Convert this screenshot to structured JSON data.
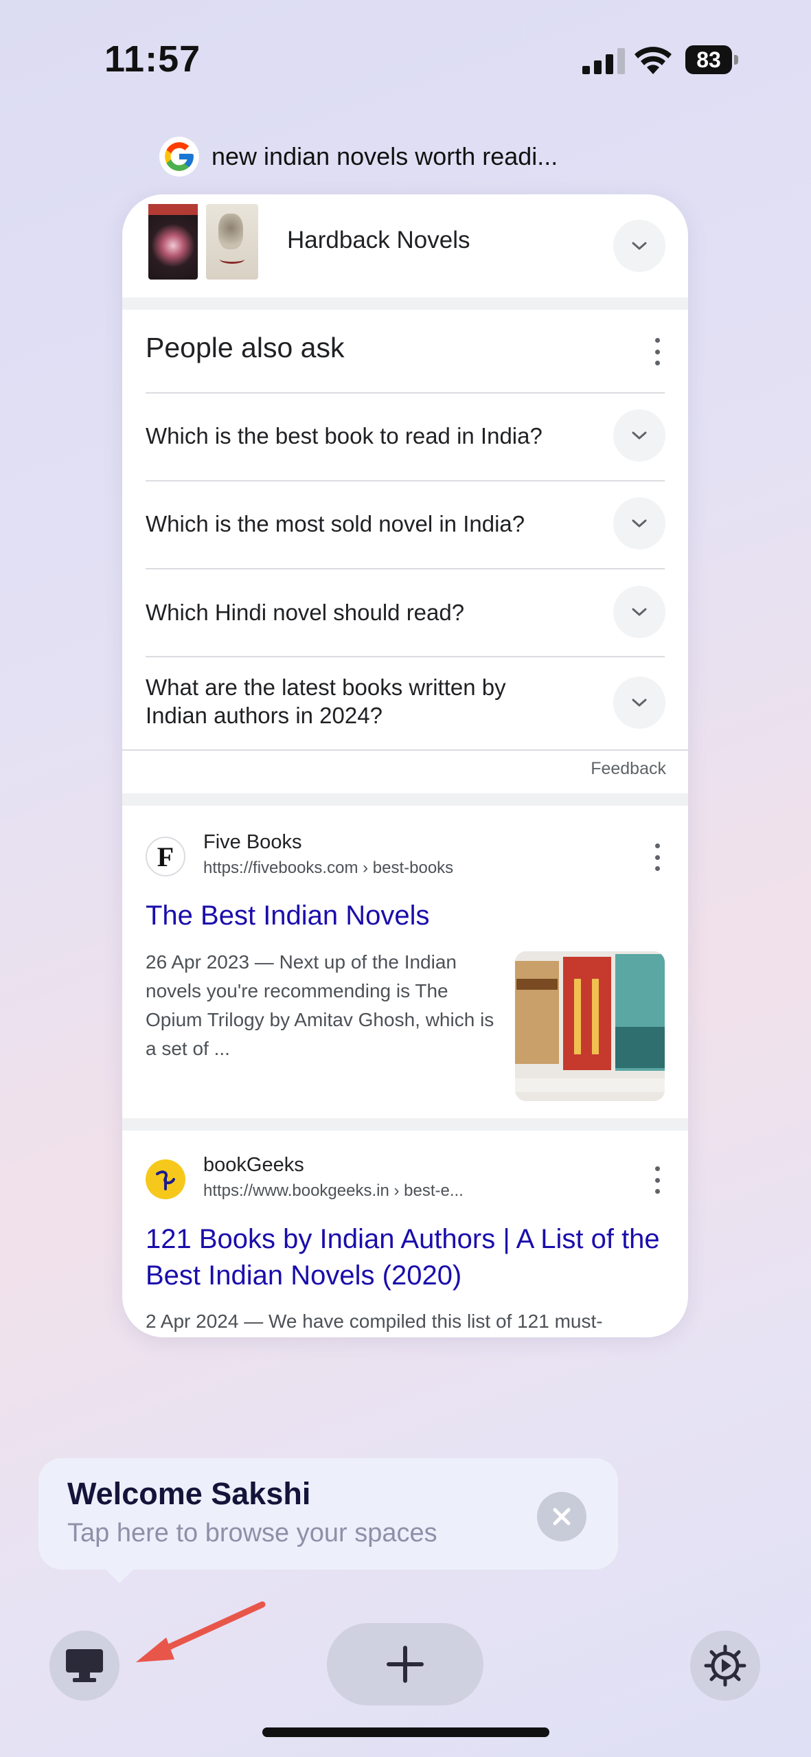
{
  "status_bar": {
    "time": "11:57",
    "battery": "83"
  },
  "tab": {
    "title": "new indian novels worth readi...",
    "favicon": "google-icon"
  },
  "search": {
    "hardback": {
      "title": "Hardback Novels"
    },
    "people_also_ask": {
      "title": "People also ask",
      "questions": [
        "Which is the best book to read in India?",
        "Which is the most sold novel in India?",
        "Which Hindi novel should read?",
        "What are the latest books written by Indian authors in 2024?"
      ],
      "feedback": "Feedback"
    },
    "results": [
      {
        "site": "Five Books",
        "url": "https://fivebooks.com › best-books",
        "title": "The Best Indian Novels",
        "snippet": "26 Apr 2023 — Next up of the Indian novels you're recommending is The Opium Trilogy by Amitav Ghosh, which is a set of ...",
        "logo_letter": "F"
      },
      {
        "site": "bookGeeks",
        "url": "https://www.bookgeeks.in › best-e...",
        "title": "121 Books by Indian Authors | A List of the Best Indian Novels (2020)",
        "snippet": "2 Apr 2024 — We have compiled this list of 121 must-"
      }
    ]
  },
  "tooltip": {
    "title": "Welcome Sakshi",
    "subtitle": "Tap here to browse your spaces"
  },
  "toolbar": {
    "spaces_icon": "desktop-icon",
    "new_tab_icon": "plus-icon",
    "settings_icon": "gear-icon"
  },
  "colors": {
    "link": "#1a0dab",
    "accent_arrow": "#e8564a",
    "background": "#e4e1f4"
  }
}
